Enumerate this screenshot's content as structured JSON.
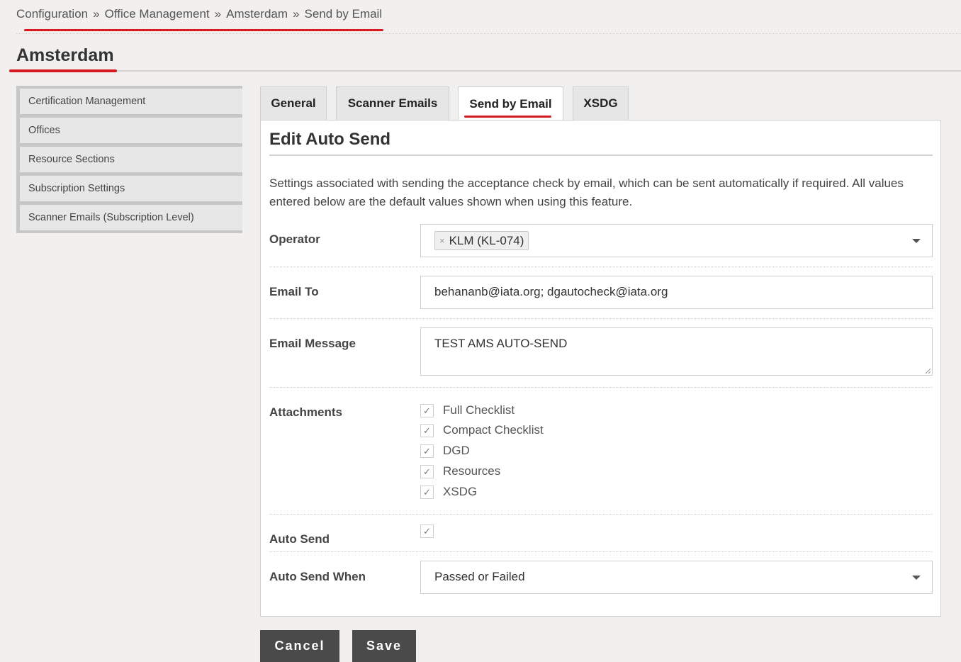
{
  "breadcrumb": {
    "items": [
      "Configuration",
      "Office Management",
      "Amsterdam",
      "Send by Email"
    ],
    "separator": "»"
  },
  "page_title": "Amsterdam",
  "sidebar": {
    "items": [
      {
        "label": "Certification Management"
      },
      {
        "label": "Offices"
      },
      {
        "label": "Resource Sections"
      },
      {
        "label": "Subscription Settings"
      },
      {
        "label": "Scanner Emails (Subscription Level)"
      }
    ]
  },
  "tabs": [
    {
      "label": "General",
      "active": false
    },
    {
      "label": "Scanner Emails",
      "active": false
    },
    {
      "label": "Send by Email",
      "active": true
    },
    {
      "label": "XSDG",
      "active": false
    }
  ],
  "panel": {
    "title": "Edit Auto Send",
    "description": "Settings associated with sending the acceptance check by email, which can be sent automatically if required. All values entered below are the default values shown when using this feature."
  },
  "form": {
    "operator": {
      "label": "Operator",
      "tag": "KLM (KL-074)",
      "remove_glyph": "×"
    },
    "email_to": {
      "label": "Email To",
      "value": "behananb@iata.org; dgautocheck@iata.org"
    },
    "email_message": {
      "label": "Email Message",
      "value": "TEST AMS AUTO-SEND"
    },
    "attachments": {
      "label": "Attachments",
      "options": [
        {
          "label": "Full Checklist",
          "checked": true
        },
        {
          "label": "Compact Checklist",
          "checked": true
        },
        {
          "label": "DGD",
          "checked": true
        },
        {
          "label": "Resources",
          "checked": true
        },
        {
          "label": "XSDG",
          "checked": true
        }
      ]
    },
    "auto_send": {
      "label": "Auto Send",
      "checked": true
    },
    "auto_send_when": {
      "label": "Auto Send When",
      "value": "Passed or Failed"
    }
  },
  "check_glyph": "✓",
  "buttons": {
    "cancel": "Cancel",
    "save": "Save"
  },
  "colors": {
    "accent_red": "#d71920",
    "button_bg": "#4a4a4a",
    "background": "#f1f0ee"
  }
}
